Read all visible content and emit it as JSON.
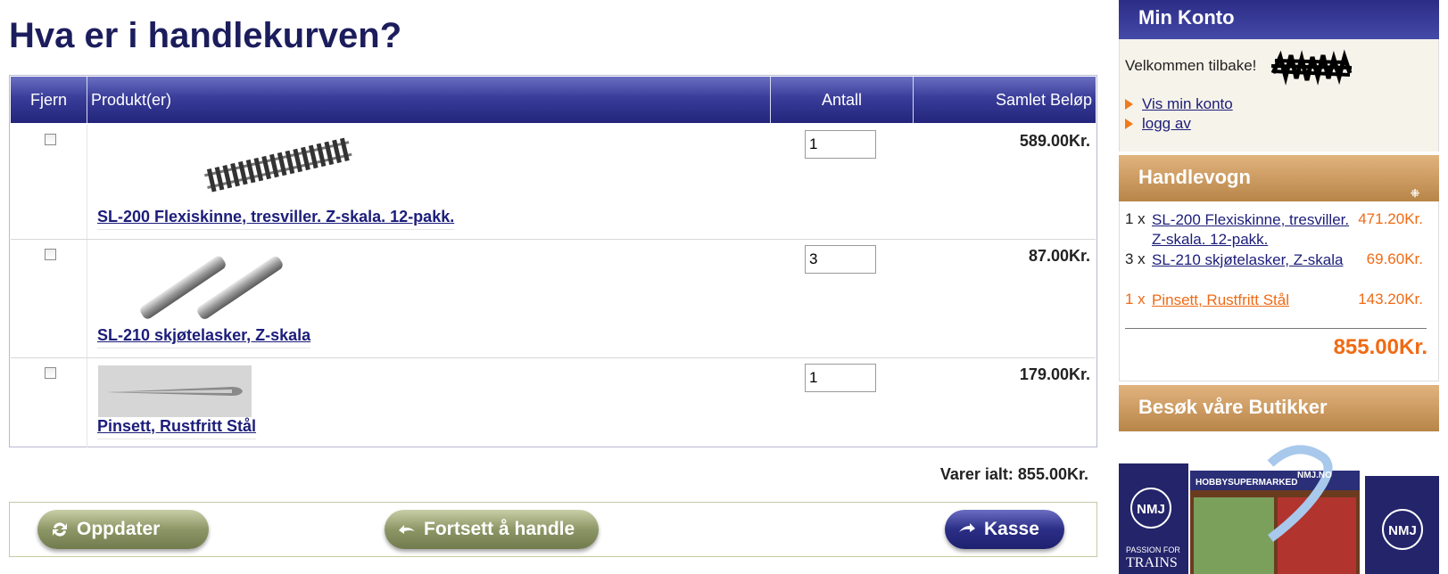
{
  "page_title": "Hva er i handlekurven?",
  "table": {
    "headers": [
      "Fjern",
      "Produkt(er)",
      "Antall",
      "Samlet Beløp"
    ],
    "rows": [
      {
        "name": "SL-200 Flexiskinne, tresviller. Z-skala. 12-pakk.",
        "qty": "1",
        "price": "589.00Kr."
      },
      {
        "name": "SL-210 skjøtelasker, Z-skala",
        "qty": "3",
        "price": "87.00Kr."
      },
      {
        "name": "Pinsett, Rustfritt Stål",
        "qty": "1",
        "price": "179.00Kr."
      }
    ]
  },
  "total_label": "Varer ialt: 855.00Kr.",
  "buttons": {
    "update": "Oppdater",
    "continue": "Fortsett å handle",
    "checkout": "Kasse"
  },
  "sidebar": {
    "konto_title": "Min Konto",
    "welcome": "Velkommen tilbake!",
    "links": [
      "Vis min konto",
      "logg av"
    ],
    "cart_title": "Handlevogn",
    "cart_items": [
      {
        "qty": "1 x",
        "name": "SL-200 Flexiskinne, tresviller. Z-skala. 12-pakk.",
        "price": "471.20Kr."
      },
      {
        "qty": "3 x",
        "name": "SL-210 skjøtelasker, Z-skala",
        "price": "69.60Kr."
      },
      {
        "qty": "1 x",
        "name": "Pinsett, Rustfritt Stål",
        "price": "143.20Kr."
      }
    ],
    "cart_total": "855.00Kr.",
    "shops_title": "Besøk våre Butikker",
    "promo": {
      "brand_left": "NMJ",
      "tagline": "PASSION FOR",
      "tagline2": "TRAINS",
      "store": "HOBBYSUPERMARKED",
      "site": "NMJ.NO",
      "brand_right": "NMJ"
    }
  },
  "colors": {
    "navy": "#2b2d85",
    "accent_orange": "#f06a14",
    "tan": "#c99a5e"
  }
}
